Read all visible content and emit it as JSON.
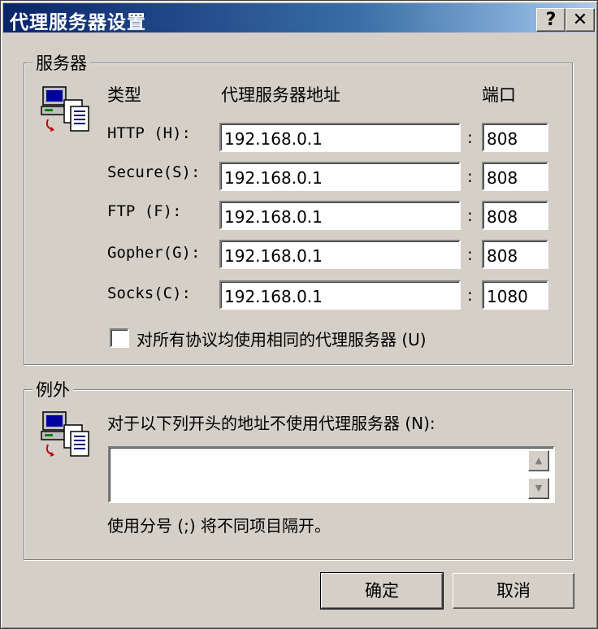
{
  "window": {
    "title": "代理服务器设置",
    "help_label": "?",
    "close_label": "✕"
  },
  "servers": {
    "group_label": "服务器",
    "icon": "network-computer-icon",
    "headers": {
      "type": "类型",
      "address": "代理服务器地址",
      "port": "端口"
    },
    "rows": [
      {
        "label": "HTTP (H):",
        "address": "192.168.0.1",
        "port": "808"
      },
      {
        "label": "Secure(S):",
        "address": "192.168.0.1",
        "port": "808"
      },
      {
        "label": "FTP (F):",
        "address": "192.168.0.1",
        "port": "808"
      },
      {
        "label": "Gopher(G):",
        "address": "192.168.0.1",
        "port": "808"
      },
      {
        "label": "Socks(C):",
        "address": "192.168.0.1",
        "port": "1080"
      }
    ],
    "colon": ":",
    "same_proxy_label": "对所有协议均使用相同的代理服务器 (U)",
    "same_proxy_checked": false
  },
  "exceptions": {
    "group_label": "例外",
    "icon": "network-computer-icon",
    "prompt": "对于以下列开头的地址不使用代理服务器 (N):",
    "value": "",
    "hint": "使用分号 (;) 将不同项目隔开。"
  },
  "buttons": {
    "ok": "确定",
    "cancel": "取消"
  }
}
